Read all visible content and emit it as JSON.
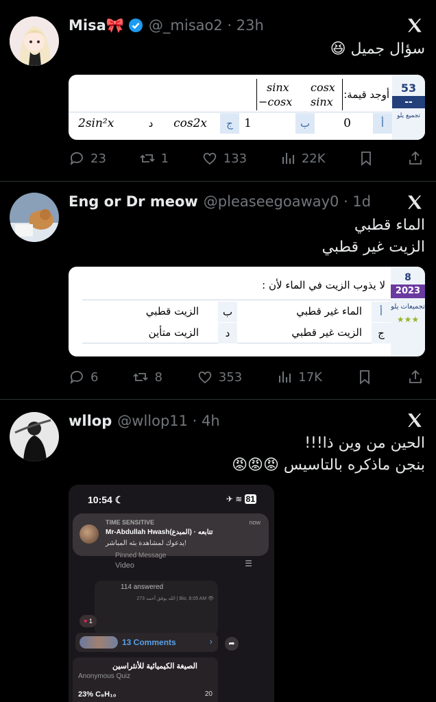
{
  "tweets": [
    {
      "name": "Misa🎀",
      "handle": "@_misao2 · 23h",
      "text_lines": [
        "سؤال جميل 😆"
      ],
      "card": {
        "number": "53",
        "dashes": "--",
        "question": "أوجد قيمة:",
        "matrix": [
          "sinx",
          "cosx",
          "−cosx",
          "sinx"
        ],
        "options": [
          {
            "letter": "أ",
            "value": "0"
          },
          {
            "letter": "ب",
            "value": "1"
          },
          {
            "letter": "ج",
            "value": "cos2x"
          },
          {
            "letter": "د",
            "value": "2sin²x"
          }
        ],
        "side_label": "تجميع يلو"
      },
      "stats": {
        "replies": "23",
        "retweets": "1",
        "likes": "133",
        "views": "22K"
      }
    },
    {
      "name": "Eng or Dr meow",
      "handle": "@pleaseegoaway0 · 1d",
      "text_lines": [
        "الماء قطبي",
        "الزيت غير قطبي"
      ],
      "card": {
        "number": "8",
        "year": "2023",
        "side_label": "تجميعات يلو",
        "stars": "★★★",
        "question": "لا يذوب الزيت في الماء لأن :",
        "options": [
          {
            "letter": "أ",
            "value": "الماء غير قطبي"
          },
          {
            "letter": "ب",
            "value": "الزيت قطبي"
          },
          {
            "letter": "ج",
            "value": "الزيت غير قطبي"
          },
          {
            "letter": "د",
            "value": "الزيت متأين"
          }
        ]
      },
      "stats": {
        "replies": "6",
        "retweets": "8",
        "likes": "353",
        "views": "17K"
      }
    },
    {
      "name": "wllop",
      "handle": "@wllop11 · 4h",
      "text_lines": [
        "الحين من وين ذا!!!",
        "بنجن ماذكره بالتاسيس 😡😡😡"
      ],
      "phone": {
        "time": "10:54",
        "battery": "81",
        "notif_label": "TIME SENSITIVE",
        "notif_time": "now",
        "notif_title": "Mr-Abdullah Hwash(المبدع) · تتابعه",
        "notif_text": "يدعوك لمشاهدة بثه المباشر!",
        "pinned": "Pinned Message",
        "video": "Video",
        "answered": "114 answered",
        "post_meta": "273 الله يوفق أحمد | Bio, 8:05 AM 👁",
        "reaction_count": "1",
        "comments": "13 Comments",
        "quiz_title": "الصيغة الكيميائية للأنثراسين",
        "quiz_type": "Anonymous Quiz",
        "quiz_option": "23%  C₈H₁₀",
        "quiz_num": "20"
      }
    }
  ]
}
